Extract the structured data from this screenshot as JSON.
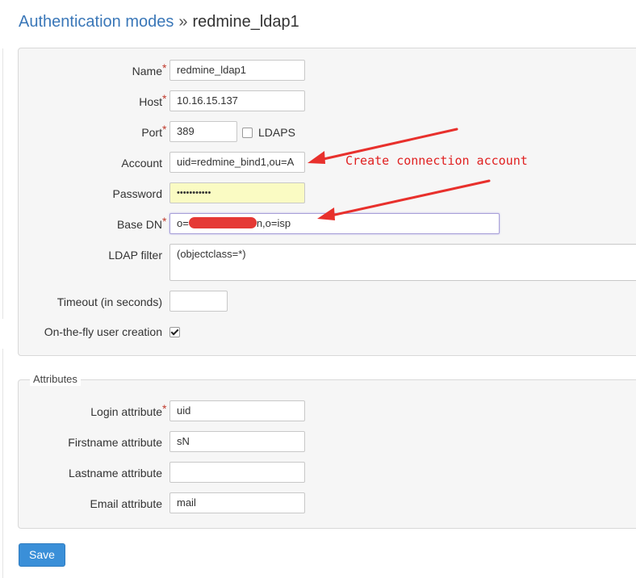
{
  "breadcrumb": {
    "parent": "Authentication modes",
    "separator": "»",
    "current": "redmine_ldap1"
  },
  "form": {
    "name": {
      "label": "Name",
      "required": "*",
      "value": "redmine_ldap1"
    },
    "host": {
      "label": "Host",
      "required": "*",
      "value": "10.16.15.137"
    },
    "port": {
      "label": "Port",
      "required": "*",
      "value": "389",
      "ldaps_label": "LDAPS",
      "ldaps_checked": false
    },
    "account": {
      "label": "Account",
      "value": "uid=redmine_bind1,ou=A"
    },
    "password": {
      "label": "Password",
      "value": "•••••••••••"
    },
    "base_dn": {
      "label": "Base DN",
      "required": "*",
      "value_prefix": "o=",
      "value_suffix": "n,o=isp"
    },
    "ldap_filter": {
      "label": "LDAP filter",
      "value": "(objectclass=*)"
    },
    "timeout": {
      "label": "Timeout (in seconds)",
      "value": ""
    },
    "onthefly": {
      "label": "On-the-fly user creation",
      "checked": true
    }
  },
  "attributes": {
    "legend": "Attributes",
    "login": {
      "label": "Login attribute",
      "required": "*",
      "value": "uid"
    },
    "firstname": {
      "label": "Firstname attribute",
      "value": "sN"
    },
    "lastname": {
      "label": "Lastname attribute",
      "value": ""
    },
    "email": {
      "label": "Email attribute",
      "value": "mail"
    }
  },
  "annotation": {
    "text": "Create connection account",
    "color": "#e02020"
  },
  "actions": {
    "save_label": "Save"
  },
  "colors": {
    "link": "#3a77b8",
    "required": "#c0392b",
    "button": "#3a8fd8",
    "password_bg": "#fafbc3"
  }
}
